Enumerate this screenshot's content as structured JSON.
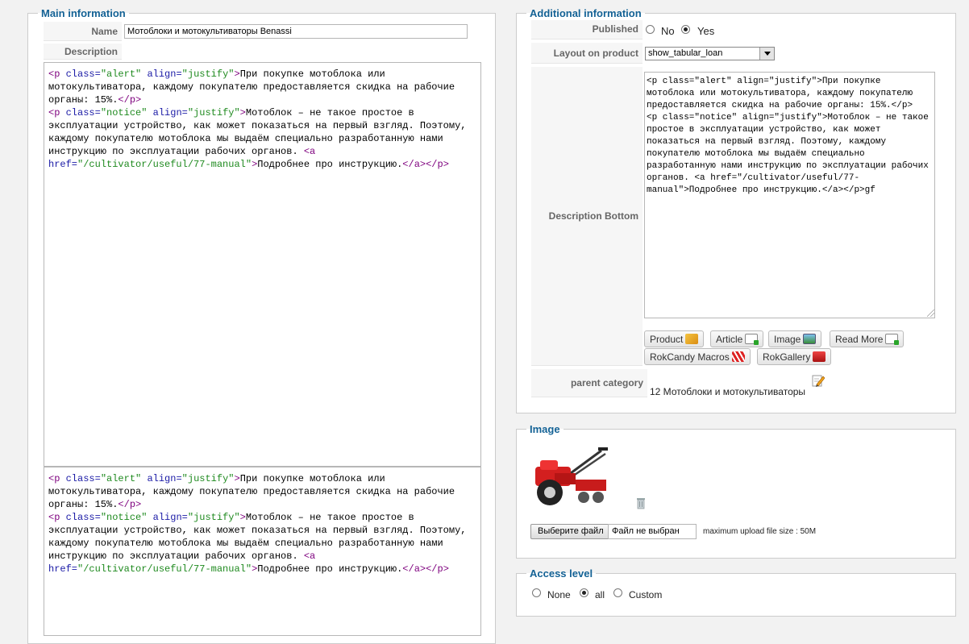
{
  "main": {
    "legend": "Main information",
    "name_label": "Name",
    "name_value": "Мотоблоки и мотокультиваторы Benassi",
    "description_label": "Description",
    "editor_segments": [
      {
        "c": "tag",
        "t": "<p "
      },
      {
        "c": "attr",
        "t": "class="
      },
      {
        "c": "str",
        "t": "\"alert\""
      },
      {
        "c": "txt",
        "t": " "
      },
      {
        "c": "attr",
        "t": "align="
      },
      {
        "c": "str",
        "t": "\"justify\""
      },
      {
        "c": "tag",
        "t": ">"
      },
      {
        "c": "txt",
        "t": "При покупке мотоблока или мотокультиватора, каждому покупателю предоставляется скидка на рабочие органы: 15%."
      },
      {
        "c": "tag",
        "t": "</p>"
      },
      {
        "c": "txt",
        "t": "\n"
      },
      {
        "c": "tag",
        "t": "<p "
      },
      {
        "c": "attr",
        "t": "class="
      },
      {
        "c": "str",
        "t": "\"notice\""
      },
      {
        "c": "txt",
        "t": " "
      },
      {
        "c": "attr",
        "t": "align="
      },
      {
        "c": "str",
        "t": "\"justify\""
      },
      {
        "c": "tag",
        "t": ">"
      },
      {
        "c": "txt",
        "t": "Мотоблок – не такое простое в эксплуатации устройство, как может показаться на первый взгляд. Поэтому, каждому покупателю мотоблока мы выдаём специально разработанную нами инструкцию по эксплуатации рабочих органов. "
      },
      {
        "c": "tag",
        "t": "<a "
      },
      {
        "c": "attr",
        "t": "href="
      },
      {
        "c": "str",
        "t": "\"/cultivator/useful/77-manual\""
      },
      {
        "c": "tag",
        "t": ">"
      },
      {
        "c": "txt",
        "t": "Подробнее про инструкцию."
      },
      {
        "c": "tag",
        "t": "</a></p>"
      }
    ],
    "editor2_segments": [
      {
        "c": "tag",
        "t": "<p "
      },
      {
        "c": "attr",
        "t": "class="
      },
      {
        "c": "str",
        "t": "\"alert\""
      },
      {
        "c": "txt",
        "t": " "
      },
      {
        "c": "attr",
        "t": "align="
      },
      {
        "c": "str",
        "t": "\"justify\""
      },
      {
        "c": "tag",
        "t": ">"
      },
      {
        "c": "txt",
        "t": "При покупке мотоблока или мотокультиватора, каждому покупателю предоставляется скидка на рабочие органы: 15%."
      },
      {
        "c": "tag",
        "t": "</p>"
      },
      {
        "c": "txt",
        "t": "\n"
      },
      {
        "c": "tag",
        "t": "<p "
      },
      {
        "c": "attr",
        "t": "class="
      },
      {
        "c": "str",
        "t": "\"notice\""
      },
      {
        "c": "txt",
        "t": " "
      },
      {
        "c": "attr",
        "t": "align="
      },
      {
        "c": "str",
        "t": "\"justify\""
      },
      {
        "c": "tag",
        "t": ">"
      },
      {
        "c": "txt",
        "t": "Мотоблок – не такое простое в эксплуатации устройство, как может показаться на первый взгляд. Поэтому, каждому покупателю мотоблока мы выдаём специально разработанную нами инструкцию по эксплуатации рабочих органов. "
      },
      {
        "c": "tag",
        "t": "<a "
      },
      {
        "c": "attr",
        "t": "href="
      },
      {
        "c": "str",
        "t": "\"/cultivator/useful/77-manual\""
      },
      {
        "c": "tag",
        "t": ">"
      },
      {
        "c": "txt",
        "t": "Подробнее про инструкцию."
      },
      {
        "c": "tag",
        "t": "</a></p>"
      }
    ]
  },
  "additional": {
    "legend": "Additional information",
    "published_label": "Published",
    "published_no": "No",
    "published_yes": "Yes",
    "published_value": "Yes",
    "layout_label": "Layout on product page",
    "layout_value": "show_tabular_loan",
    "desc_bottom_label": "Description Bottom",
    "desc_bottom_value": "<p class=\"alert\" align=\"justify\">При покупке мотоблока или мотокультиватора, каждому покупателю предоставляется скидка на рабочие органы: 15%.</p>\n<p class=\"notice\" align=\"justify\">Мотоблок – не такое простое в эксплуатации устройство, как может показаться на первый взгляд. Поэтому, каждому покупателю мотоблока мы выдаём специально разработанную нами инструкцию по эксплуатации рабочих органов. <a href=\"/cultivator/useful/77-manual\">Подробнее про инструкцию.</a></p>gf",
    "buttons": {
      "product": "Product",
      "article": "Article",
      "image": "Image",
      "readmore": "Read More",
      "rokcandy": "RokCandy Macros",
      "rokgallery": "RokGallery"
    },
    "parent_label": "parent category",
    "parent_value": "12 Мотоблоки и мотокультиваторы",
    "icons": {
      "edit": "edit-pencil-icon"
    }
  },
  "image_section": {
    "legend": "Image",
    "choose_file": "Выберите файл",
    "no_file": "Файл не выбран",
    "max_size": "maximum upload file size : 50M"
  },
  "access": {
    "legend": "Access level",
    "none": "None",
    "all": "all",
    "custom": "Custom",
    "value": "all"
  }
}
